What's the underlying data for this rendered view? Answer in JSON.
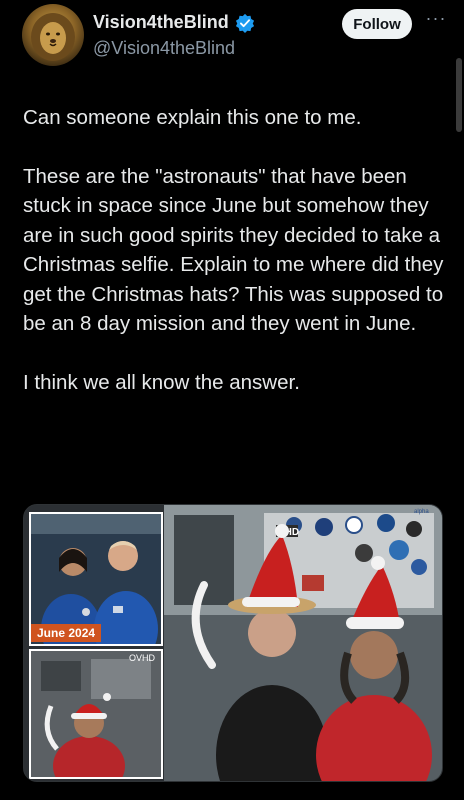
{
  "author": {
    "display_name": "Vision4theBlind",
    "handle": "@Vision4theBlind",
    "verified_icon": "verified-badge-icon",
    "avatar_icon": "lion-avatar-icon"
  },
  "actions": {
    "follow_label": "Follow",
    "more_label": "···"
  },
  "tweet": {
    "paragraph_1": "Can someone explain this one to me.",
    "paragraph_2": "These are the \"astronauts\" that have been stuck in space since June but somehow they are in such good spirits they decided to take a Christmas selfie. Explain to me where did they get the Christmas hats? This was supposed to be an 8 day mission and they went in June.",
    "paragraph_3": "I think we all know the answer."
  },
  "media": {
    "inset_label": "June 2024",
    "panel_label": "VHD",
    "bottom_panel_label": "OVHD",
    "logo_text": "alpha"
  },
  "colors": {
    "background": "#000000",
    "text": "#e7e9ea",
    "secondary_text": "#8b98a5",
    "verified_blue": "#1d9bf0",
    "follow_bg": "#eff3f4",
    "date_label_bg": "#d0541f",
    "hat_red": "#c8201f"
  }
}
